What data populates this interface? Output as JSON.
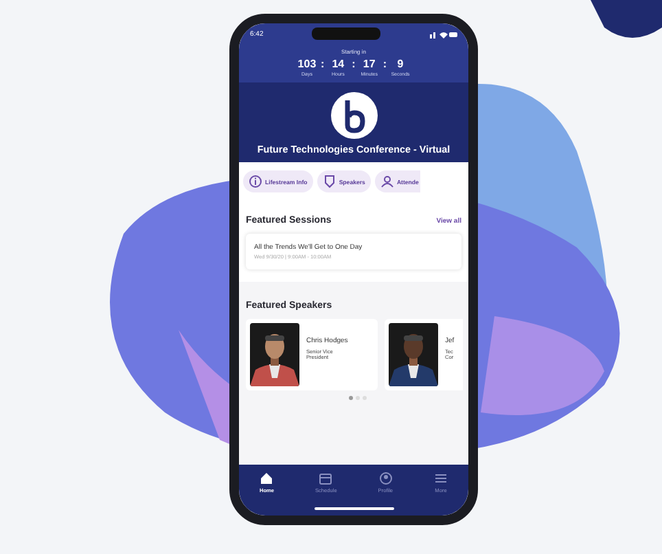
{
  "status_bar": {
    "time": "6:42"
  },
  "countdown": {
    "label": "Starting in",
    "units": [
      {
        "value": "103",
        "unit": "Days"
      },
      {
        "value": "14",
        "unit": "Hours"
      },
      {
        "value": "17",
        "unit": "Minutes"
      },
      {
        "value": "9",
        "unit": "Seconds"
      }
    ],
    "separator": ":"
  },
  "event": {
    "title": "Future Technologies Conference - Virtual"
  },
  "chips": [
    {
      "label": "Lifestream Info"
    },
    {
      "label": "Speakers"
    },
    {
      "label": "Attende"
    }
  ],
  "featured_sessions": {
    "heading": "Featured Sessions",
    "link": "View all",
    "sessions": [
      {
        "title": "All the Trends We'll Get to One Day",
        "time": "Wed 9/30/20 | 9:00AM - 10:00AM"
      }
    ]
  },
  "featured_speakers": {
    "heading": "Featured Speakers",
    "speakers": [
      {
        "name": "Chris Hodges",
        "role": "Senior Vice President",
        "kind": "picture"
      },
      {
        "name": "Jef",
        "role": "Tec Cor",
        "kind": "picture"
      }
    ],
    "pager": [
      {
        "selected": true
      },
      {
        "selected": false
      },
      {
        "selected": false
      }
    ]
  },
  "tab_bar": [
    {
      "label": "Home",
      "selected": true
    },
    {
      "label": "Schedule",
      "selected": false
    },
    {
      "label": "Profile",
      "selected": false
    },
    {
      "label": "More",
      "selected": false
    }
  ]
}
